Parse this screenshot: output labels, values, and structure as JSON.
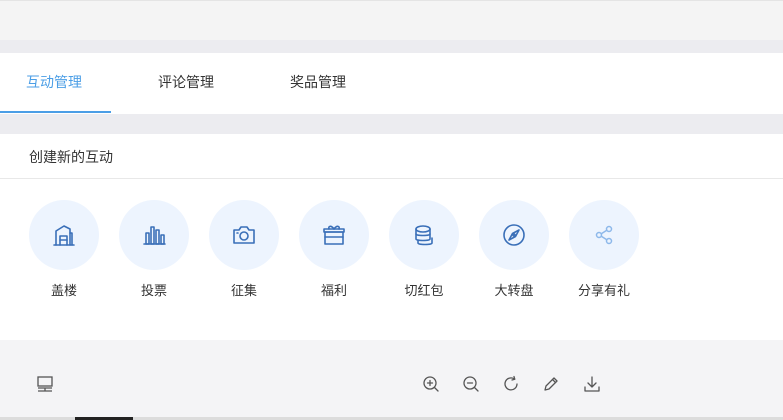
{
  "tabs": [
    {
      "label": "互动管理",
      "active": true
    },
    {
      "label": "评论管理",
      "active": false
    },
    {
      "label": "奖品管理",
      "active": false
    }
  ],
  "create_section": {
    "title": "创建新的互动",
    "actions": [
      {
        "label": "盖楼",
        "icon": "building-icon"
      },
      {
        "label": "投票",
        "icon": "bar-chart-icon"
      },
      {
        "label": "征集",
        "icon": "camera-icon"
      },
      {
        "label": "福利",
        "icon": "gift-icon"
      },
      {
        "label": "切红包",
        "icon": "coin-stack-icon"
      },
      {
        "label": "大转盘",
        "icon": "compass-icon"
      },
      {
        "label": "分享有礼",
        "icon": "share-icon"
      }
    ]
  },
  "toolbar": {
    "tools": [
      "layout-icon",
      "zoom-in-icon",
      "zoom-out-icon",
      "rotate-icon",
      "edit-icon",
      "download-icon"
    ]
  },
  "colors": {
    "accent": "#4b9ee6",
    "icon_stroke": "#3a6fb8",
    "icon_bg": "#edf4fe",
    "share_stroke": "#8db8ea"
  }
}
